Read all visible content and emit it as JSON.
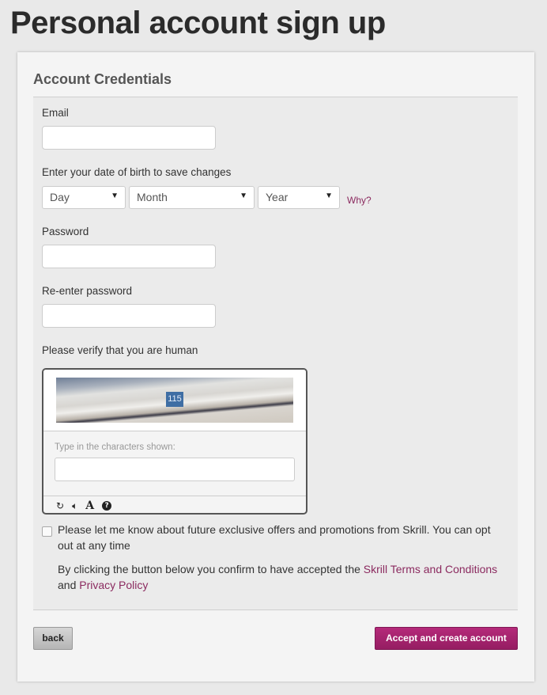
{
  "page": {
    "title": "Personal account sign up"
  },
  "section": {
    "title": "Account Credentials"
  },
  "form": {
    "email": {
      "label": "Email",
      "value": "",
      "placeholder": ""
    },
    "dob": {
      "label": "Enter your date of birth to save changes",
      "day": {
        "selected": "Day"
      },
      "month": {
        "selected": "Month"
      },
      "year": {
        "selected": "Year"
      },
      "why_link": "Why?"
    },
    "password": {
      "label": "Password",
      "value": ""
    },
    "reenter_password": {
      "label": "Re-enter password",
      "value": ""
    },
    "captcha": {
      "label": "Please verify that you are human",
      "image_text": "115",
      "prompt": "Type in the characters shown:",
      "value": "",
      "icons": [
        "refresh-icon",
        "audio-icon",
        "font-icon",
        "help-icon"
      ]
    },
    "offers_checkbox": {
      "checked": false,
      "label": "Please let me know about future exclusive offers and promotions from Skrill. You can opt out at any time"
    },
    "terms": {
      "prefix": "By clicking the button below you confirm to have accepted the ",
      "terms_link": "Skrill Terms and Conditions",
      "middle": " and ",
      "privacy_link": "Privacy Policy"
    }
  },
  "buttons": {
    "back": "back",
    "accept": "Accept and create account"
  },
  "colors": {
    "accent": "#a3226c",
    "link": "#8b2a5f"
  }
}
